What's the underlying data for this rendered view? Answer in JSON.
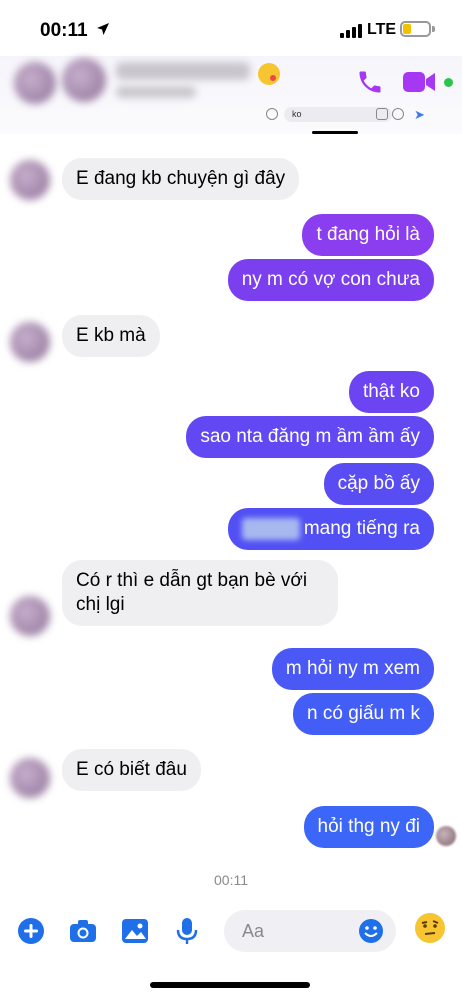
{
  "status_bar": {
    "time": "00:11",
    "location_icon": "location-arrow-icon",
    "network": "LTE",
    "battery_color": "#f2c200"
  },
  "header": {
    "contact_name_redacted": true,
    "phone_icon": "phone-icon",
    "video_icon": "video-camera-icon",
    "accent_color": "#a637f2",
    "online_color": "#2cc44a",
    "mini_input_value": "ko"
  },
  "messages": [
    {
      "side": "in",
      "text": "E đang kb chuyện gì đây"
    },
    {
      "side": "out",
      "text": "t đang hỏi là"
    },
    {
      "side": "out",
      "text": "ny m có vợ con chưa"
    },
    {
      "side": "in",
      "text": "E kb mà"
    },
    {
      "side": "out",
      "text": "thật ko"
    },
    {
      "side": "out",
      "text": "sao nta đăng m ầm ầm ấy"
    },
    {
      "side": "out",
      "text": "cặp bồ ấy"
    },
    {
      "side": "out",
      "text": "mang tiếng ra",
      "redacted_prefix": true
    },
    {
      "side": "in",
      "text_line1": "Có r thì e dẫn gt bạn bè với",
      "text_line2": "chị lgi"
    },
    {
      "side": "out",
      "text": "m hỏi ny m xem"
    },
    {
      "side": "out",
      "text": "n có giấu m k"
    },
    {
      "side": "in",
      "text": "E có biết đâu"
    },
    {
      "side": "out",
      "text": "hỏi thg ny đi"
    }
  ],
  "timestamp": "00:11",
  "composer": {
    "placeholder": "Aa",
    "icons": [
      "plus-icon",
      "camera-icon",
      "image-icon",
      "microphone-icon",
      "smiley-icon",
      "emoji-icon"
    ]
  }
}
